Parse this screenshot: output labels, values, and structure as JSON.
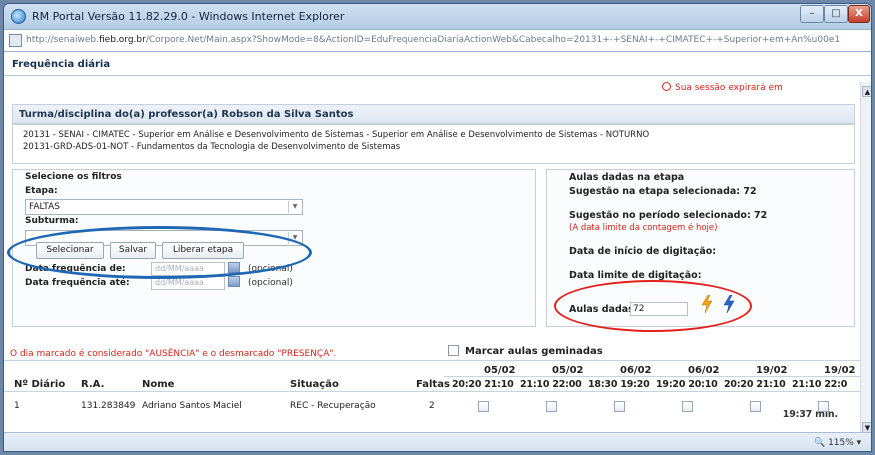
{
  "window": {
    "title": "RM Portal Versão 11.82.29.0 - Windows Internet Explorer",
    "url_prefix": "http://senaiweb.",
    "url_domain": "fieb.org.br",
    "url_rest": "/Corpore.Net/Main.aspx?ShowMode=8&ActionID=EduFrequenciaDiariaActionWeb&Cabecalho=20131+-+SENAI+-+CIMATEC+-+Superior+em+An%u00e1",
    "controls": {
      "minimize": "–",
      "maximize": "□",
      "close": "X"
    }
  },
  "page": {
    "title": "Frequência diária",
    "session_prefix": "Sua sessão expirará em",
    "session_time": "19:37 min."
  },
  "header": {
    "title": "Turma/disciplina do(a) professor(a) Robson da Silva Santos",
    "line1": "20131 - SENAI - CIMATEC - Superior em Análise e Desenvolvimento de Sistemas - Superior em Análise e Desenvolvimento de Sistemas - NOTURNO",
    "line2": "20131-GRD-ADS-01-NOT - Fundamentos da Tecnologia de Desenvolvimento de Sistemas"
  },
  "filters": {
    "title": "Selecione os filtros",
    "etapa_label": "Etapa:",
    "etapa_value": "FALTAS",
    "subturma_label": "Subturma:",
    "subturma_value": "",
    "data_de_label": "Data frequência de:",
    "data_ate_label": "Data frequência até:",
    "date_placeholder": "dd/MM/aaaa",
    "optional": "(opcional)",
    "buttons": {
      "selecionar": "Selecionar",
      "salvar": "Salvar",
      "liberar": "Liberar etapa"
    }
  },
  "summary": {
    "title": "Aulas dadas na etapa",
    "sugestao_etapa": "Sugestão na etapa selecionada: 72",
    "sugestao_periodo": "Sugestão no período selecionado: 72",
    "nota": "(A data limite da contagem é hoje)",
    "inicio": "Data de início de digitação:",
    "limite": "Data limite de digitação:",
    "aulas_label": "Aulas dadas:",
    "aulas_value": "72"
  },
  "legend": "O dia marcado é considerado \"AUSÊNCIA\" e o desmarcado \"PRESENÇA\".",
  "geminadas_label": "Marcar aulas geminadas",
  "table": {
    "headers": {
      "diario": "Nº Diário",
      "ra": "R.A.",
      "nome": "Nome",
      "situacao": "Situação",
      "faltas": "Faltas"
    },
    "dates": [
      "05/02",
      "05/02",
      "06/02",
      "06/02",
      "19/02",
      "19/02"
    ],
    "times": [
      "20:20 21:10",
      "21:10 22:00",
      "18:30 19:20",
      "19:20 20:10",
      "20:20 21:10",
      "21:10 22:0"
    ],
    "rows": [
      {
        "diario": "1",
        "ra": "131.283849",
        "nome": "Adriano Santos Maciel",
        "situacao": "REC - Recuperação",
        "faltas": "2"
      }
    ]
  },
  "status": {
    "zoom": "115%"
  }
}
